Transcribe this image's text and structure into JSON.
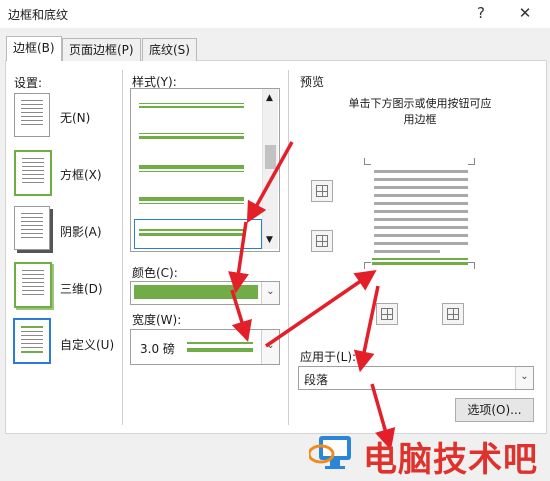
{
  "window": {
    "title": "边框和底纹",
    "help_label": "?",
    "close_label": "✕"
  },
  "tabs": [
    {
      "label": "边框(B)",
      "active": true
    },
    {
      "label": "页面边框(P)",
      "active": false
    },
    {
      "label": "底纹(S)",
      "active": false
    }
  ],
  "settings": {
    "heading": "设置:",
    "items": [
      {
        "label": "无(N)"
      },
      {
        "label": "方框(X)"
      },
      {
        "label": "阴影(A)"
      },
      {
        "label": "三维(D)"
      },
      {
        "label": "自定义(U)",
        "selected": true
      }
    ]
  },
  "style": {
    "label": "样式(Y):"
  },
  "color": {
    "label": "颜色(C):",
    "value_hex": "#70ad47"
  },
  "width": {
    "label": "宽度(W):",
    "value": "3.0 磅"
  },
  "preview": {
    "heading": "预览",
    "instruction_line1": "单击下方图示或使用按钮可应",
    "instruction_line2": "用边框"
  },
  "apply_to": {
    "label": "应用于(L):",
    "value": "段落"
  },
  "options_button": "选项(O)...",
  "watermark": {
    "text": "电脑技术吧"
  },
  "colors": {
    "accent_green": "#70ad47",
    "arrow_red": "#e3202a",
    "selection_blue": "#2d7bd8"
  }
}
